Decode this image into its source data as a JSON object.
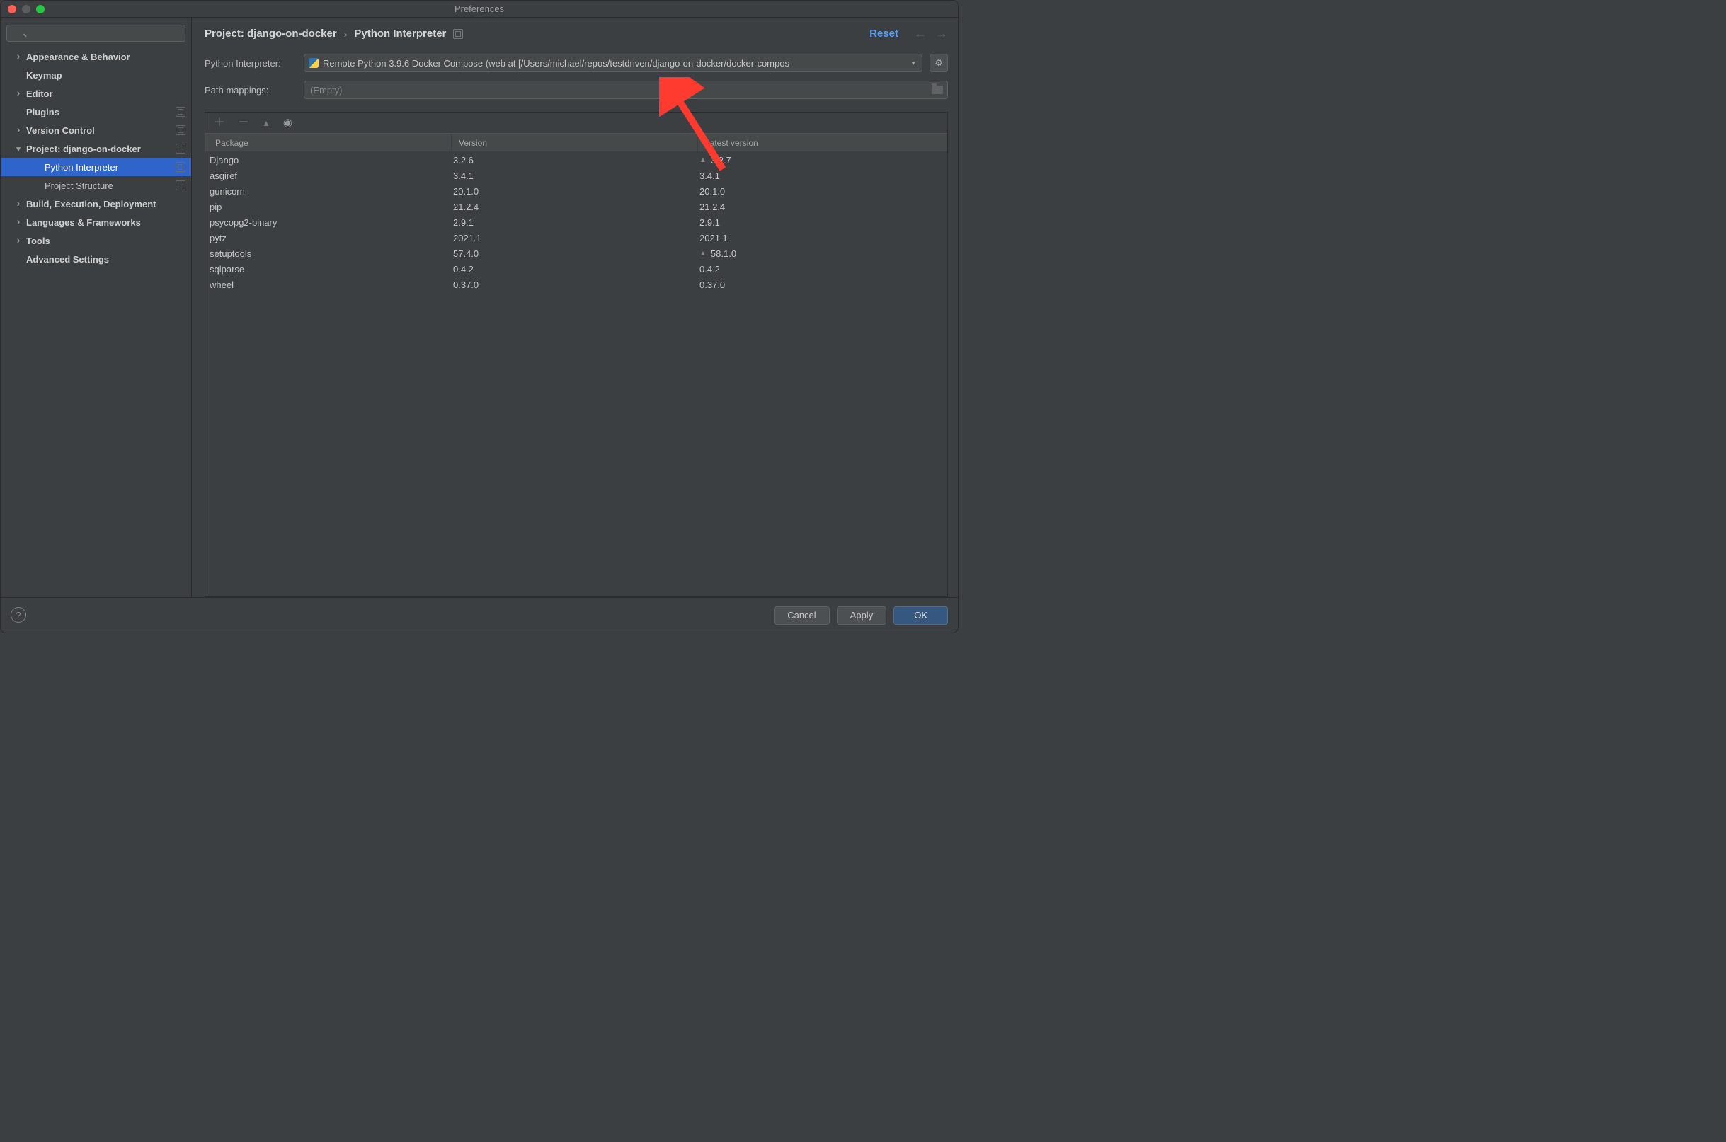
{
  "window": {
    "title": "Preferences"
  },
  "sidebar": {
    "search_placeholder": "",
    "items": [
      {
        "label": "Appearance & Behavior",
        "bold": true,
        "chev": "right"
      },
      {
        "label": "Keymap",
        "bold": true,
        "chev": "none"
      },
      {
        "label": "Editor",
        "bold": true,
        "chev": "right"
      },
      {
        "label": "Plugins",
        "bold": true,
        "chev": "none",
        "icon": true
      },
      {
        "label": "Version Control",
        "bold": true,
        "chev": "right",
        "icon": true
      },
      {
        "label": "Project: django-on-docker",
        "bold": true,
        "chev": "down",
        "icon": true
      },
      {
        "label": "Python Interpreter",
        "bold": false,
        "chev": "none",
        "child": true,
        "selected": true,
        "icon": true
      },
      {
        "label": "Project Structure",
        "bold": false,
        "chev": "none",
        "child": true,
        "icon": true
      },
      {
        "label": "Build, Execution, Deployment",
        "bold": true,
        "chev": "right"
      },
      {
        "label": "Languages & Frameworks",
        "bold": true,
        "chev": "right"
      },
      {
        "label": "Tools",
        "bold": true,
        "chev": "right"
      },
      {
        "label": "Advanced Settings",
        "bold": true,
        "chev": "none"
      }
    ]
  },
  "breadcrumb": {
    "project": "Project: django-on-docker",
    "page": "Python Interpreter",
    "reset": "Reset"
  },
  "form": {
    "interpreter_label": "Python Interpreter:",
    "interpreter_value": "Remote Python 3.9.6 Docker Compose (web at [/Users/michael/repos/testdriven/django-on-docker/docker-compos",
    "path_label": "Path mappings:",
    "path_value": "(Empty)"
  },
  "packages": {
    "headers": {
      "package": "Package",
      "version": "Version",
      "latest": "Latest version"
    },
    "rows": [
      {
        "name": "Django",
        "version": "3.2.6",
        "latest": "3.2.7",
        "upgrade": true
      },
      {
        "name": "asgiref",
        "version": "3.4.1",
        "latest": "3.4.1"
      },
      {
        "name": "gunicorn",
        "version": "20.1.0",
        "latest": "20.1.0"
      },
      {
        "name": "pip",
        "version": "21.2.4",
        "latest": "21.2.4"
      },
      {
        "name": "psycopg2-binary",
        "version": "2.9.1",
        "latest": "2.9.1"
      },
      {
        "name": "pytz",
        "version": "2021.1",
        "latest": "2021.1"
      },
      {
        "name": "setuptools",
        "version": "57.4.0",
        "latest": "58.1.0",
        "upgrade": true
      },
      {
        "name": "sqlparse",
        "version": "0.4.2",
        "latest": "0.4.2"
      },
      {
        "name": "wheel",
        "version": "0.37.0",
        "latest": "0.37.0"
      }
    ]
  },
  "buttons": {
    "cancel": "Cancel",
    "apply": "Apply",
    "ok": "OK"
  }
}
